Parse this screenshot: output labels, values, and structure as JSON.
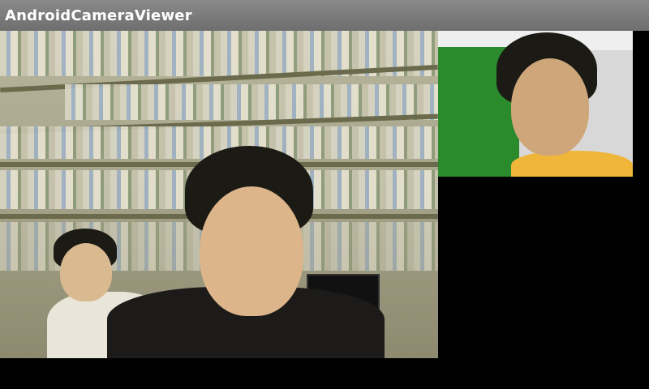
{
  "app": {
    "title": "AndroidCameraViewer"
  },
  "feeds": {
    "main": "remote-camera-feed",
    "self": "local-camera-preview"
  },
  "colors": {
    "titlebar": "#7a7a7a",
    "background": "#000000",
    "green_wall": "#2a8a2c",
    "orange_shirt": "#f0b63a"
  }
}
